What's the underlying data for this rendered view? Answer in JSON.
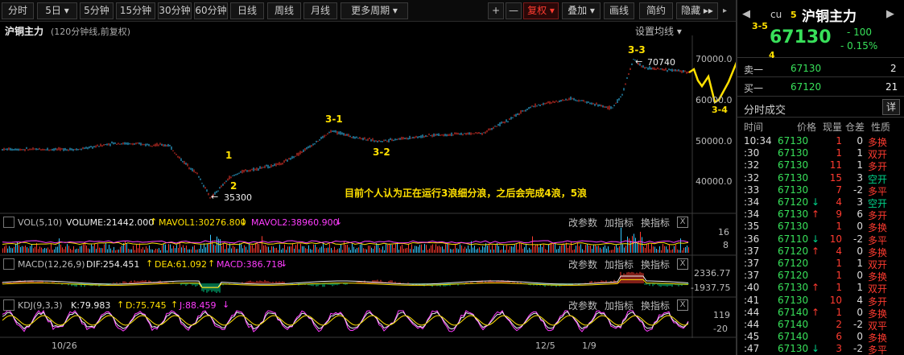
{
  "toolbar": {
    "buttons": [
      {
        "label": "分时",
        "name": "tab-intraday"
      },
      {
        "label": "5日 ▾",
        "name": "tab-5day"
      },
      {
        "label": "5分钟",
        "name": "tab-5min"
      },
      {
        "label": "15分钟",
        "name": "tab-15min"
      },
      {
        "label": "30分钟",
        "name": "tab-30min"
      },
      {
        "label": "60分钟",
        "name": "tab-60min"
      },
      {
        "label": "日线",
        "name": "tab-daily"
      },
      {
        "label": "周线",
        "name": "tab-weekly"
      },
      {
        "label": "月线",
        "name": "tab-monthly"
      },
      {
        "label": "更多周期 ▾",
        "name": "tab-more-periods"
      }
    ],
    "right_buttons": [
      {
        "label": "+",
        "name": "zoom-in-button"
      },
      {
        "label": "—",
        "name": "zoom-out-button"
      },
      {
        "label": "复权 ▾",
        "name": "adjust-button",
        "active": true
      },
      {
        "label": "叠加 ▾",
        "name": "overlay-button"
      },
      {
        "label": "画线",
        "name": "draw-line-button"
      },
      {
        "label": "简约",
        "name": "simple-mode-button"
      },
      {
        "label": "隐藏 ▸▸",
        "name": "hide-button"
      }
    ]
  },
  "chart": {
    "title": "沪铜主力",
    "subtitle": "(120分钟线,前复权)",
    "settings_label": "设置均线 ▾",
    "price_axis": [
      "70000.0",
      "60000.0",
      "50000.0",
      "40000.0"
    ],
    "annotation_text": "目前个人认为正在运行3浪细分浪，之后会完成4浪，5浪",
    "high_label": "70740",
    "low_label": "35300",
    "wave_labels": [
      "1",
      "2",
      "3-1",
      "3-2",
      "3-3",
      "3-4",
      "3-5",
      "4",
      "5",
      "cu"
    ],
    "date_labels": [
      "10/26",
      "12/5",
      "1/9"
    ]
  },
  "vol": {
    "prefix": "VOL(5,10)",
    "value": "VOLUME:21442.000",
    "ma1": "MAVOL1:30276.800",
    "ma2": "MAVOL2:38960.900",
    "axis": [
      "16",
      "8"
    ]
  },
  "macd": {
    "prefix": "MACD(12,26,9)",
    "dif": "DIF:254.451",
    "dea": "DEA:61.092",
    "macd": "MACD:386.718",
    "axis": [
      "2336.77",
      "-1937.75"
    ]
  },
  "kdj": {
    "prefix": "KDJ(9,3,3)",
    "k": "K:79.983",
    "d": "D:75.745",
    "j": "J:88.459",
    "axis": [
      "119",
      "-20"
    ]
  },
  "pane_tools": {
    "change_params": "改参数",
    "add_indicator": "加指标",
    "switch_indicator": "换指标",
    "close": "X"
  },
  "quote": {
    "name": "沪铜主力",
    "last_price": "67130",
    "change": "- 100",
    "change_pct": "- 0.15%",
    "ask_label": "卖一",
    "ask_price": "67130",
    "ask_vol": "2",
    "bid_label": "买一",
    "bid_price": "67120",
    "bid_vol": "21",
    "trades_title": "分时成交",
    "detail_label": "详",
    "trades_header": [
      "时间",
      "价格",
      "现量",
      "仓差",
      "性质"
    ]
  },
  "trades": [
    {
      "t": "10:34",
      "p": "67130",
      "arrow": "",
      "v": "1",
      "d": "0",
      "n": "多换"
    },
    {
      "t": ":30",
      "p": "67130",
      "arrow": "",
      "v": "1",
      "d": "1",
      "n": "双开"
    },
    {
      "t": ":32",
      "p": "67130",
      "arrow": "",
      "v": "11",
      "d": "1",
      "n": "多开"
    },
    {
      "t": ":32",
      "p": "67130",
      "arrow": "",
      "v": "15",
      "d": "3",
      "n": "空开"
    },
    {
      "t": ":33",
      "p": "67130",
      "arrow": "",
      "v": "7",
      "d": "-2",
      "n": "多平"
    },
    {
      "t": ":34",
      "p": "67120",
      "arrow": "↓",
      "v": "4",
      "d": "3",
      "n": "空开"
    },
    {
      "t": ":34",
      "p": "67130",
      "arrow": "↑",
      "v": "9",
      "d": "6",
      "n": "多开"
    },
    {
      "t": ":35",
      "p": "67130",
      "arrow": "",
      "v": "1",
      "d": "0",
      "n": "多换"
    },
    {
      "t": ":36",
      "p": "67110",
      "arrow": "↓",
      "v": "10",
      "d": "-2",
      "n": "多平"
    },
    {
      "t": ":37",
      "p": "67120",
      "arrow": "↑",
      "v": "4",
      "d": "0",
      "n": "多换"
    },
    {
      "t": ":37",
      "p": "67120",
      "arrow": "",
      "v": "1",
      "d": "1",
      "n": "双开"
    },
    {
      "t": ":37",
      "p": "67120",
      "arrow": "",
      "v": "1",
      "d": "0",
      "n": "多换"
    },
    {
      "t": ":40",
      "p": "67130",
      "arrow": "↑",
      "v": "1",
      "d": "1",
      "n": "双开"
    },
    {
      "t": ":41",
      "p": "67130",
      "arrow": "",
      "v": "10",
      "d": "4",
      "n": "多开"
    },
    {
      "t": ":44",
      "p": "67140",
      "arrow": "↑",
      "v": "1",
      "d": "0",
      "n": "多换"
    },
    {
      "t": ":44",
      "p": "67140",
      "arrow": "",
      "v": "2",
      "d": "-2",
      "n": "双平"
    },
    {
      "t": ":45",
      "p": "67140",
      "arrow": "",
      "v": "6",
      "d": "0",
      "n": "多换"
    },
    {
      "t": ":47",
      "p": "67130",
      "arrow": "↓",
      "v": "3",
      "d": "-2",
      "n": "多平"
    }
  ],
  "colors": {
    "up": "#ff3b30",
    "down": "#00d48a",
    "cyan": "#37c8ff",
    "yellow": "#ffe000",
    "magenta": "#ff3cff",
    "price_green": "#38e05a"
  }
}
